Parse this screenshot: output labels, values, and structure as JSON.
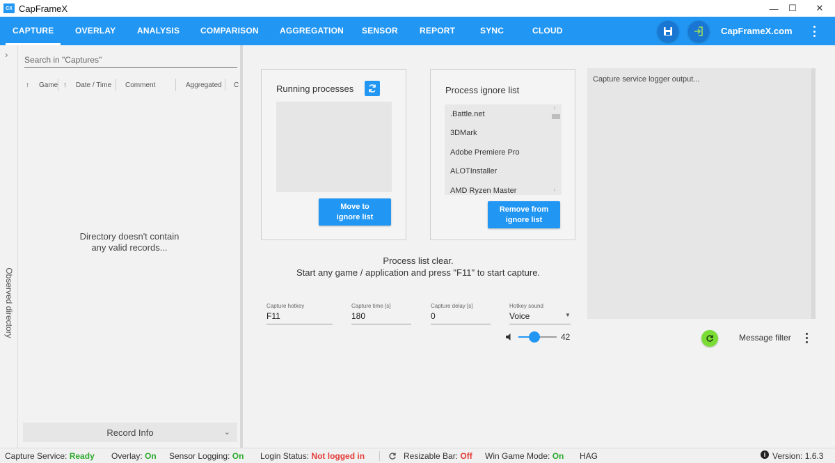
{
  "app": {
    "title": "CapFrameX",
    "logo_text": "CX"
  },
  "window_controls": {
    "minimize": "—",
    "maximize": "☐",
    "close": "✕"
  },
  "nav": {
    "tabs": [
      "CAPTURE",
      "OVERLAY",
      "ANALYSIS",
      "COMPARISON",
      "AGGREGATION",
      "SENSOR",
      "REPORT",
      "SYNC",
      "CLOUD"
    ],
    "active_tab": "CAPTURE",
    "site": "CapFrameX.com",
    "icons": [
      "save-icon",
      "login-icon",
      "more-vert-icon"
    ]
  },
  "sidebar": {
    "label": "Observed directory",
    "chevron": "›"
  },
  "captures": {
    "search_placeholder": "Search in \"Captures\"",
    "columns": [
      "Game",
      "Date / Time",
      "Comment",
      "Aggregated",
      "C"
    ],
    "sort_arrow": "↑",
    "empty_line1": "Directory doesn't contain",
    "empty_line2": "any valid records...",
    "record_info": "Record Info",
    "record_chevron": "⌄"
  },
  "running_processes": {
    "title": "Running processes",
    "move_btn_line1": "Move to",
    "move_btn_line2": "ignore list"
  },
  "ignore_list": {
    "title": "Process ignore list",
    "items": [
      ".Battle.net",
      "3DMark",
      "Adobe Premiere Pro",
      "ALOTInstaller",
      "AMD Ryzen Master"
    ],
    "remove_btn_line1": "Remove from",
    "remove_btn_line2": "ignore list"
  },
  "status_message": {
    "line1": "Process list clear.",
    "line2": "Start any game / application and press \"F11\" to start capture."
  },
  "settings": {
    "hotkey_label": "Capture hotkey",
    "hotkey_value": "F11",
    "time_label": "Capture time [s]",
    "time_value": "180",
    "delay_label": "Capture delay [s]",
    "delay_value": "0",
    "sound_label": "Hotkey sound",
    "sound_value": "Voice",
    "volume": 42,
    "volume_display": "42"
  },
  "logger": {
    "placeholder": "Capture service logger output...",
    "filter_label": "Message filter"
  },
  "statusbar": {
    "capture_service_label": "Capture Service:",
    "capture_service_value": "Ready",
    "overlay_label": "Overlay:",
    "overlay_value": "On",
    "sensor_label": "Sensor Logging:",
    "sensor_value": "On",
    "login_label": "Login Status:",
    "login_value": "Not logged in",
    "rebar_label": "Resizable Bar:",
    "rebar_value": "Off",
    "gamemode_label": "Win Game Mode:",
    "gamemode_value": "On",
    "truncated": "HAG",
    "version": "Version: 1.6.3"
  },
  "colors": {
    "accent": "#2196f3",
    "status_green": "#2eaa2e",
    "status_red": "#e53935",
    "refresh_green": "#7bdc35"
  }
}
